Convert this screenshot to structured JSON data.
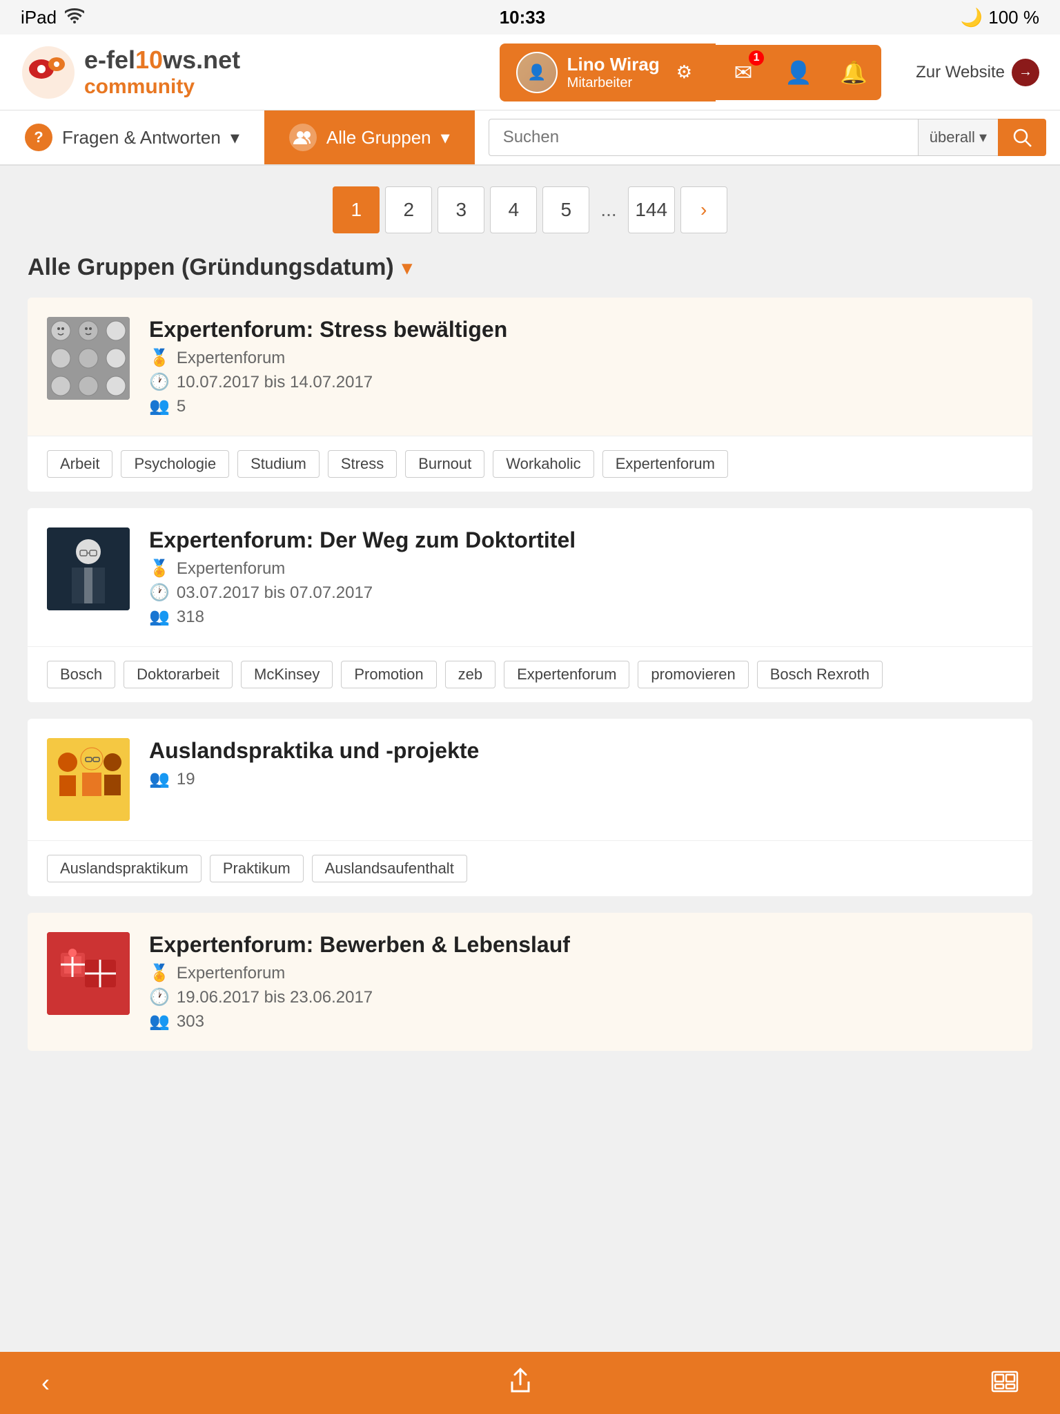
{
  "statusBar": {
    "device": "iPad",
    "wifi": "wifi",
    "time": "10:33",
    "moon": "🌙",
    "battery": "100 %"
  },
  "header": {
    "logoTop": "e-fel",
    "logoHighlight": "10",
    "logoEnd": "ws.net",
    "logoCommunity": "community",
    "userName": "Lino Wirag",
    "userRole": "Mitarbeiter",
    "websiteLink": "Zur Website"
  },
  "nav": {
    "item1": "Fragen & Antworten",
    "item1Dropdown": "▾",
    "item2": "Alle Gruppen",
    "item2Dropdown": "▾",
    "searchPlaceholder": "Suchen",
    "searchScope": "überall ▾"
  },
  "pagination": {
    "pages": [
      "1",
      "2",
      "3",
      "4",
      "5",
      "...",
      "144"
    ],
    "activePage": "1",
    "nextArrow": "›"
  },
  "sectionTitle": "Alle Gruppen (Gründungsdatum)",
  "groups": [
    {
      "id": "stress",
      "title": "Expertenforum: Stress bewältigen",
      "category": "Expertenforum",
      "date": "10.07.2017 bis 14.07.2017",
      "members": "5",
      "tags": [
        "Arbeit",
        "Psychologie",
        "Studium",
        "Stress",
        "Burnout",
        "Workaholic",
        "Expertenforum"
      ],
      "thumbType": "stress"
    },
    {
      "id": "doktor",
      "title": "Expertenforum: Der Weg zum Doktortitel",
      "category": "Expertenforum",
      "date": "03.07.2017 bis 07.07.2017",
      "members": "318",
      "tags": [
        "Bosch",
        "Doktorarbeit",
        "McKinsey",
        "Promotion",
        "zeb",
        "Expertenforum",
        "promovieren",
        "Bosch Rexroth"
      ],
      "thumbType": "doktor"
    },
    {
      "id": "ausland",
      "title": "Auslandspraktika und -projekte",
      "category": "",
      "date": "",
      "members": "19",
      "tags": [
        "Auslandspraktikum",
        "Praktikum",
        "Auslandsaufenthalt"
      ],
      "thumbType": "ausland"
    },
    {
      "id": "bewerben",
      "title": "Expertenforum: Bewerben & Lebenslauf",
      "category": "Expertenforum",
      "date": "19.06.2017 bis 23.06.2017",
      "members": "303",
      "tags": [],
      "thumbType": "bewerben"
    }
  ],
  "bottomBar": {
    "backIcon": "‹",
    "shareIcon": "⬆",
    "galleryIcon": "⊞"
  }
}
